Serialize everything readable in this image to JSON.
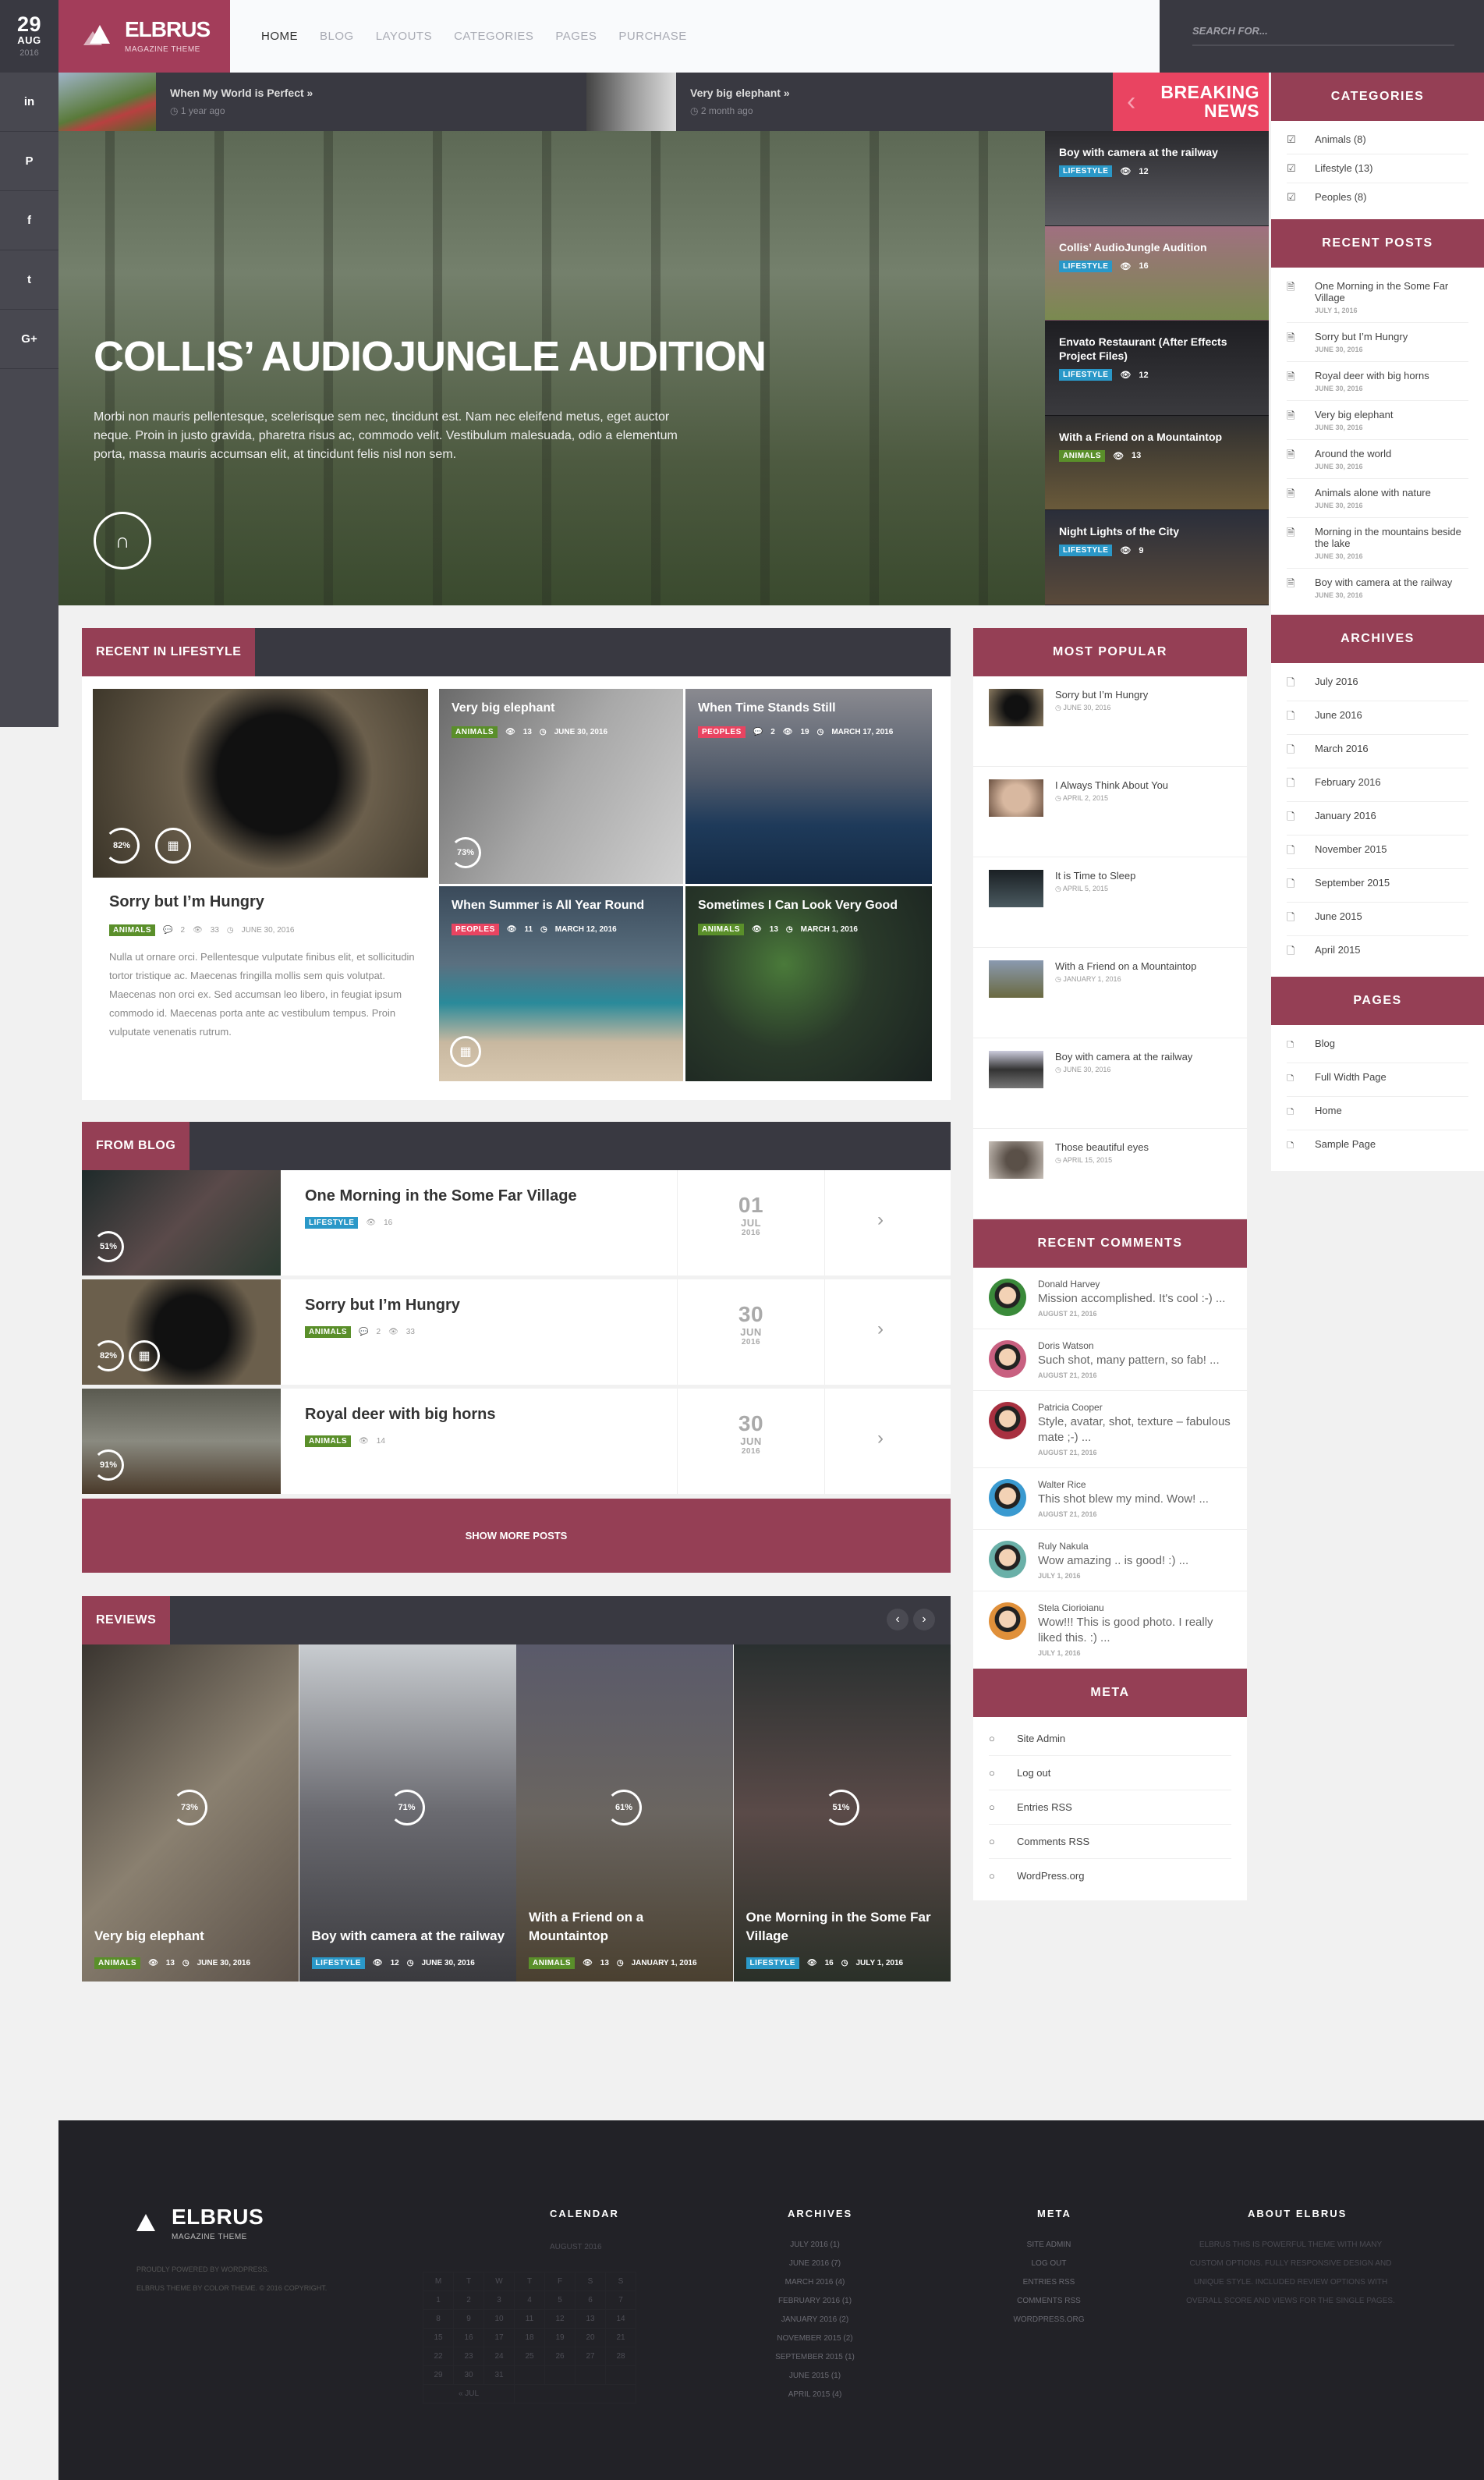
{
  "date": {
    "day": "29",
    "month": "AUG",
    "year": "2016"
  },
  "social": [
    {
      "icon": "linkedin-icon",
      "glyph": "in"
    },
    {
      "icon": "pinterest-icon",
      "glyph": "P"
    },
    {
      "icon": "facebook-icon",
      "glyph": "f"
    },
    {
      "icon": "twitter-icon",
      "glyph": "t"
    },
    {
      "icon": "google-plus-icon",
      "glyph": "G+"
    }
  ],
  "logo": {
    "title": "ELBRUS",
    "subtitle": "MAGAZINE THEME"
  },
  "nav": [
    {
      "label": "HOME",
      "active": true
    },
    {
      "label": "BLOG"
    },
    {
      "label": "LAYOUTS"
    },
    {
      "label": "CATEGORIES"
    },
    {
      "label": "PAGES"
    },
    {
      "label": "PURCHASE"
    }
  ],
  "search": {
    "placeholder": "SEARCH FOR..."
  },
  "ticker": [
    {
      "title": "When My World is Perfect »",
      "ago": "1 year ago"
    },
    {
      "title": "Very big elephant »",
      "ago": "2 month ago"
    }
  ],
  "breaking": {
    "label1": "BREAKING",
    "label2": "NEWS"
  },
  "hero": {
    "title": "COLLIS’ AUDIOJUNGLE AUDITION",
    "text": "Morbi non mauris pellentesque, scelerisque sem nec, tincidunt est. Nam nec eleifend metus, eget auctor neque. Proin in justo gravida, pharetra risus ac, commodo velit. Vestibulum malesuada, odio a elementum porta, massa mauris accumsan elit, at tincidunt felis nisl non sem."
  },
  "hero_list": [
    {
      "title": "Boy with camera at the railway",
      "tag": "LIFESTYLE",
      "tagclass": "lifestyle",
      "views": "12"
    },
    {
      "title": "Collis’ AudioJungle Audition",
      "tag": "LIFESTYLE",
      "tagclass": "lifestyle",
      "views": "16"
    },
    {
      "title": "Envato Restaurant (After Effects Project Files)",
      "tag": "LIFESTYLE",
      "tagclass": "lifestyle",
      "views": "12"
    },
    {
      "title": "With a Friend on a Mountaintop",
      "tag": "ANIMALS",
      "tagclass": "animals",
      "views": "13"
    },
    {
      "title": "Night Lights of the City",
      "tag": "LIFESTYLE",
      "tagclass": "lifestyle",
      "views": "9"
    }
  ],
  "lifestyle": {
    "heading": "RECENT IN LIFESTYLE",
    "feature": {
      "title": "Sorry but I’m Hungry",
      "tag": "ANIMALS",
      "comments": "2",
      "views": "33",
      "date": "JUNE 30, 2016",
      "score": "82%",
      "text": "Nulla ut ornare orci. Pellentesque vulputate finibus elit, et sollicitudin tortor tristique ac. Maecenas fringilla mollis sem quis volutpat. Maecenas non orci ex. Sed accumsan leo libero, in feugiat ipsum commodo id. Maecenas porta ante ac vestibulum tempus. Proin vulputate venenatis rutrum."
    },
    "tiles": [
      {
        "title": "Very big elephant",
        "tag": "ANIMALS",
        "tagclass": "animals",
        "comments": "",
        "views": "13",
        "date": "JUNE 30, 2016",
        "score": "73%"
      },
      {
        "title": "When Time Stands Still",
        "tag": "PEOPLES",
        "tagclass": "peoples",
        "comments": "2",
        "views": "19",
        "date": "MARCH 17, 2016",
        "score": ""
      },
      {
        "title": "When Summer is All Year Round",
        "tag": "PEOPLES",
        "tagclass": "peoples",
        "comments": "",
        "views": "11",
        "date": "MARCH 12, 2016",
        "score": ""
      },
      {
        "title": "Sometimes I Can Look Very Good",
        "tag": "ANIMALS",
        "tagclass": "animals",
        "comments": "",
        "views": "13",
        "date": "MARCH 1, 2016",
        "score": ""
      }
    ]
  },
  "blog": {
    "heading": "FROM BLOG",
    "more": "SHOW MORE POSTS",
    "rows": [
      {
        "title": "One Morning in the Some Far Village",
        "tag": "LIFESTYLE",
        "tagclass": "lifestyle",
        "comments": "",
        "views": "16",
        "day": "01",
        "month": "JUL",
        "year": "2016",
        "score": "51%"
      },
      {
        "title": "Sorry but I’m Hungry",
        "tag": "ANIMALS",
        "tagclass": "animals",
        "comments": "2",
        "views": "33",
        "day": "30",
        "month": "JUN",
        "year": "2016",
        "score": "82%"
      },
      {
        "title": "Royal deer with big horns",
        "tag": "ANIMALS",
        "tagclass": "animals",
        "comments": "",
        "views": "14",
        "day": "30",
        "month": "JUN",
        "year": "2016",
        "score": "91%"
      }
    ]
  },
  "reviews": {
    "heading": "REVIEWS",
    "items": [
      {
        "title": "Very big elephant",
        "tag": "ANIMALS",
        "tagclass": "animals",
        "views": "13",
        "date": "JUNE 30, 2016",
        "score": "73%"
      },
      {
        "title": "Boy with camera at the railway",
        "tag": "LIFESTYLE",
        "tagclass": "lifestyle",
        "views": "12",
        "date": "JUNE 30, 2016",
        "score": "71%"
      },
      {
        "title": "With a Friend on a Mountaintop",
        "tag": "ANIMALS",
        "tagclass": "animals",
        "views": "13",
        "date": "JANUARY 1, 2016",
        "score": "61%"
      },
      {
        "title": "One Morning in the Some Far Village",
        "tag": "LIFESTYLE",
        "tagclass": "lifestyle",
        "views": "16",
        "date": "JULY 1, 2016",
        "score": "51%"
      }
    ]
  },
  "most_popular": {
    "heading": "MOST POPULAR",
    "items": [
      {
        "title": "Sorry but I’m Hungry",
        "date": "JUNE 30, 2016"
      },
      {
        "title": "I Always Think About You",
        "date": "APRIL 2, 2015"
      },
      {
        "title": "It is Time to Sleep",
        "date": "APRIL 5, 2015"
      },
      {
        "title": "With a Friend on a Mountaintop",
        "date": "JANUARY 1, 2016"
      },
      {
        "title": "Boy with camera at the railway",
        "date": "JUNE 30, 2016"
      },
      {
        "title": "Those beautiful eyes",
        "date": "APRIL 15, 2015"
      }
    ]
  },
  "recent_comments": {
    "heading": "RECENT COMMENTS",
    "items": [
      {
        "name": "Donald Harvey",
        "text": "Mission accomplished. It's cool :-) ...",
        "date": "AUGUST 21, 2016"
      },
      {
        "name": "Doris Watson",
        "text": "Such shot, many pattern, so fab! ...",
        "date": "AUGUST 21, 2016"
      },
      {
        "name": "Patricia Cooper",
        "text": "Style, avatar, shot, texture – fabulous mate ;-) ...",
        "date": "AUGUST 21, 2016"
      },
      {
        "name": "Walter Rice",
        "text": "This shot blew my mind. Wow! ...",
        "date": "AUGUST 21, 2016"
      },
      {
        "name": "Ruly Nakula",
        "text": "Wow amazing .. is good! :) ...",
        "date": "JULY 1, 2016"
      },
      {
        "name": "Stela Ciorioianu",
        "text": "Wow!!! This is good photo. I really liked this. :) ...",
        "date": "JULY 1, 2016"
      }
    ]
  },
  "meta": {
    "heading": "META",
    "items": [
      "Site Admin",
      "Log out",
      "Entries RSS",
      "Comments RSS",
      "WordPress.org"
    ]
  },
  "categories": {
    "heading": "CATEGORIES",
    "items": [
      "Animals (8)",
      "Lifestyle (13)",
      "Peoples (8)"
    ]
  },
  "recent_posts": {
    "heading": "RECENT POSTS",
    "items": [
      {
        "title": "One Morning in the Some Far Village",
        "date": "JULY 1, 2016"
      },
      {
        "title": "Sorry but I’m Hungry",
        "date": "JUNE 30, 2016"
      },
      {
        "title": "Royal deer with big horns",
        "date": "JUNE 30, 2016"
      },
      {
        "title": "Very big elephant",
        "date": "JUNE 30, 2016"
      },
      {
        "title": "Around the world",
        "date": "JUNE 30, 2016"
      },
      {
        "title": "Animals alone with nature",
        "date": "JUNE 30, 2016"
      },
      {
        "title": "Morning in the mountains beside the lake",
        "date": "JUNE 30, 2016"
      },
      {
        "title": "Boy with camera at the railway",
        "date": "JUNE 30, 2016"
      }
    ]
  },
  "archives": {
    "heading": "ARCHIVES",
    "items": [
      "July 2016",
      "June 2016",
      "March 2016",
      "February 2016",
      "January 2016",
      "November 2015",
      "September 2015",
      "June 2015",
      "April 2015"
    ]
  },
  "pages": {
    "heading": "PAGES",
    "items": [
      "Blog",
      "Full Width Page",
      "Home",
      "Sample Page"
    ]
  },
  "footer": {
    "logo_title": "ELBRUS",
    "logo_sub": "MAGAZINE THEME",
    "powered": "PROUDLY POWERED BY WORDPRESS.",
    "credit": "ELBRUS THEME BY COLOR THEME. © 2016 COPYRIGHT.",
    "calendar": {
      "heading": "CALENDAR",
      "month": "AUGUST 2016",
      "days": [
        "M",
        "T",
        "W",
        "T",
        "F",
        "S",
        "S"
      ],
      "weeks": [
        [
          "1",
          "2",
          "3",
          "4",
          "5",
          "6",
          "7"
        ],
        [
          "8",
          "9",
          "10",
          "11",
          "12",
          "13",
          "14"
        ],
        [
          "15",
          "16",
          "17",
          "18",
          "19",
          "20",
          "21"
        ],
        [
          "22",
          "23",
          "24",
          "25",
          "26",
          "27",
          "28"
        ],
        [
          "29",
          "30",
          "31",
          "",
          "",
          "",
          ""
        ]
      ],
      "prev": "« JUL"
    },
    "archives_heading": "ARCHIVES",
    "archives": [
      "JULY 2016 (1)",
      "JUNE 2016 (7)",
      "MARCH 2016 (4)",
      "FEBRUARY 2016 (1)",
      "JANUARY 2016 (2)",
      "NOVEMBER 2015 (2)",
      "SEPTEMBER 2015 (1)",
      "JUNE 2015 (1)",
      "APRIL 2015 (4)"
    ],
    "meta_heading": "META",
    "meta": [
      "SITE ADMIN",
      "LOG OUT",
      "ENTRIES RSS",
      "COMMENTS RSS",
      "WORDPRESS.ORG"
    ],
    "about_heading": "ABOUT ELBRUS",
    "about": "ELBRUS THIS IS POWERFUL THEME WITH MANY CUSTOM OPTIONS. FULLY RESPONSIVE DESIGN AND UNIQUE STYLE. INCLUDED REVIEW OPTIONS WITH OVERALL SCORE AND VIEWS FOR THE SINGLE PAGES."
  },
  "colors": {
    "brand": "#a33d5a",
    "widget": "#953f55",
    "dark": "#393941",
    "breaking": "#e94461",
    "lifestyle": "#2a98c8",
    "animals": "#5a8f2a",
    "peoples": "#e94461"
  }
}
